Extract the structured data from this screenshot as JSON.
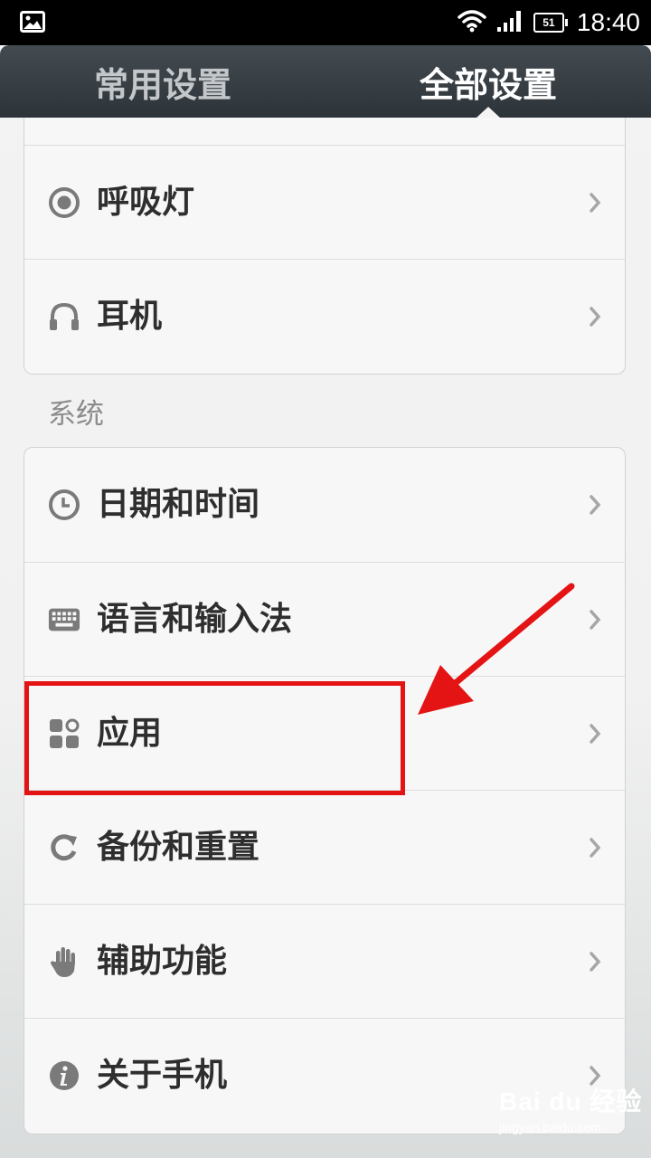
{
  "status_bar": {
    "time": "18:40",
    "battery": "51"
  },
  "tabs": [
    {
      "label": "常用设置",
      "active": false
    },
    {
      "label": "全部设置",
      "active": true
    }
  ],
  "group1": [
    {
      "label": "呼吸灯",
      "icon": "breathing-light-icon"
    },
    {
      "label": "耳机",
      "icon": "headphones-icon"
    }
  ],
  "section_system": "系统",
  "system_items": [
    {
      "label": "日期和时间",
      "icon": "clock-icon"
    },
    {
      "label": "语言和输入法",
      "icon": "keyboard-icon"
    },
    {
      "label": "应用",
      "icon": "apps-icon"
    },
    {
      "label": "备份和重置",
      "icon": "refresh-icon"
    },
    {
      "label": "辅助功能",
      "icon": "hand-icon"
    },
    {
      "label": "关于手机",
      "icon": "info-icon"
    }
  ],
  "watermark": {
    "main": "Bai du 经验",
    "sub": "jingyan.baidu.com"
  },
  "colors": {
    "tab_bar": "#3a4247",
    "annotation_red": "#e41414",
    "label_text": "#2e2e2e",
    "icon_gray": "#7a7a7a"
  }
}
